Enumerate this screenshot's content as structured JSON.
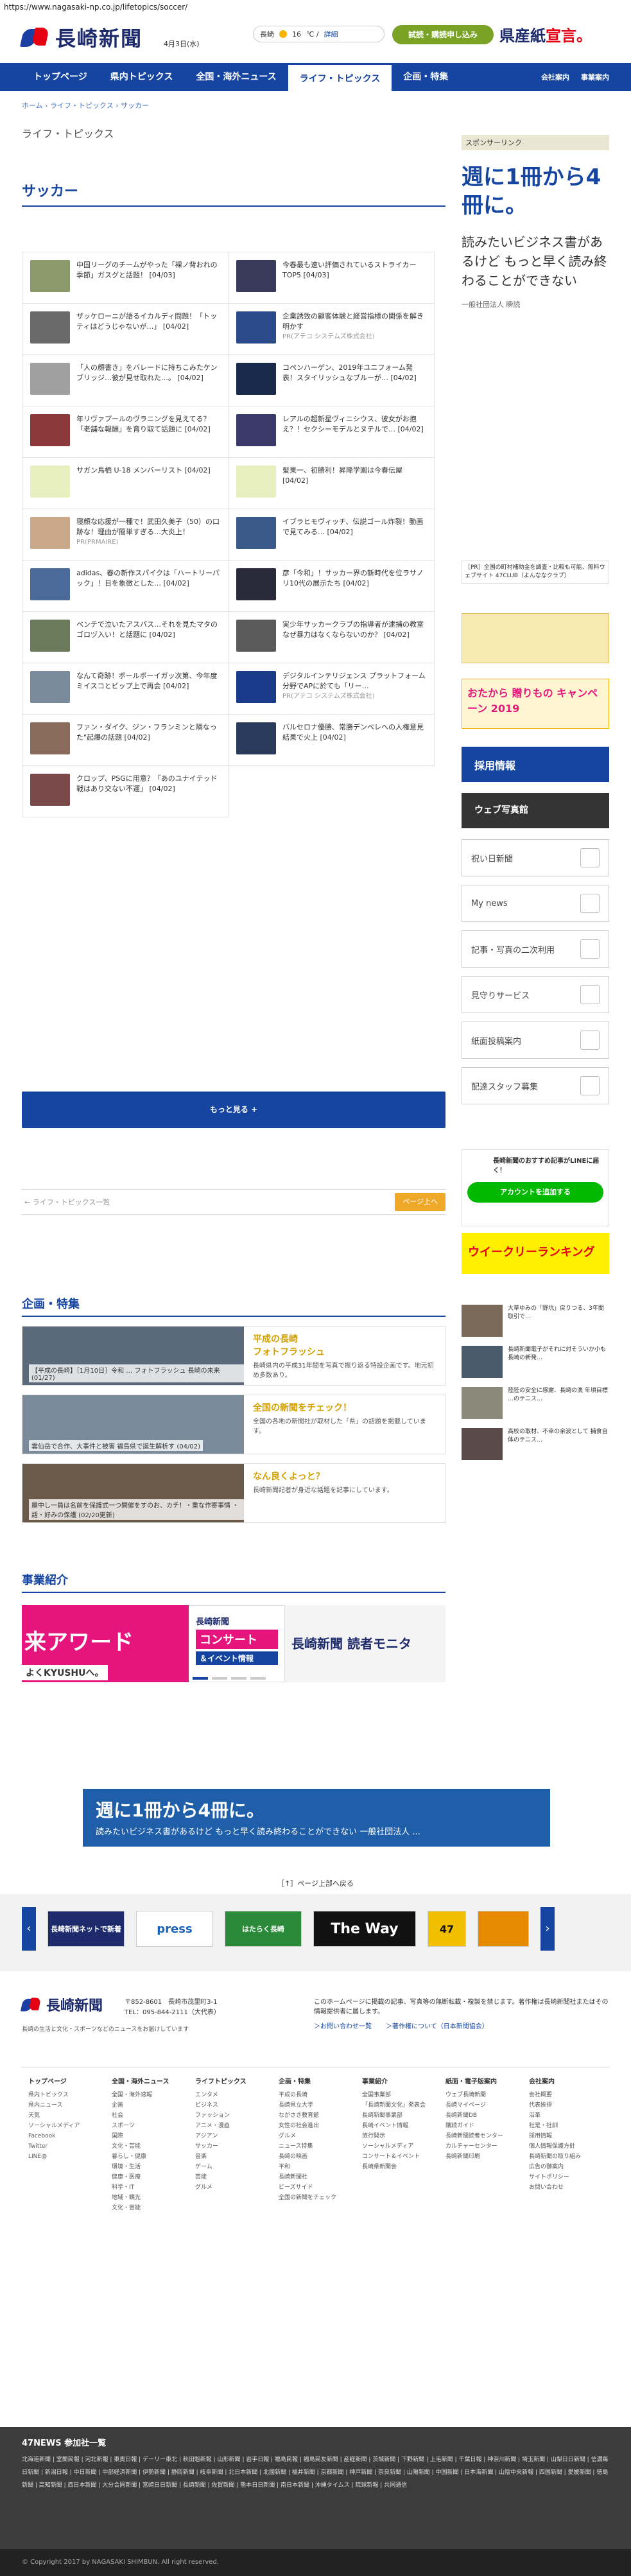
{
  "url": "https://www.nagasaki-np.co.jp/lifetopics/soccer/",
  "header": {
    "logo_text": "長崎新聞",
    "date": "4月3日(水)",
    "weather_city": "長崎",
    "weather_temp": "16",
    "weather_unit": "℃ /",
    "weather_more": "詳細",
    "trial_button": "試読・購読申し込み",
    "banner_main": "県産紙",
    "banner_red": "宣言。"
  },
  "nav": {
    "items": [
      "トップページ",
      "県内トピックス",
      "全国・海外ニュース",
      "ライフ・トピックス",
      "企画・特集"
    ],
    "active_index": 3,
    "right": [
      "会社案内",
      "事業案内"
    ]
  },
  "breadcrumb": "ホーム › ライフ・トピックス › サッカー",
  "section_label": "ライフ・トピックス",
  "page_title": "サッカー",
  "topics": [
    {
      "text": "中国リーグのチームがやった「裸ノ背おれの季節」ガスグと話題！ [04/03]",
      "color": "#8a9a6a"
    },
    {
      "text": "今春最も速い評価されているストライカーTOP5 [04/03]",
      "color": "#3a3a5a"
    },
    {
      "text": "ザッケローニが語るイカルディ問題！「トッティはどうじゃないが…」 [04/02]",
      "color": "#6a6a6a"
    },
    {
      "text": "企業誘致の顧客体験と経営指標の関係を解き明かす",
      "src": "PR(アテコ システムズ株式会社)",
      "color": "#2a4a8a"
    },
    {
      "text": "「人の顔書き」をバレードに持ちこみたケンブリッジ…彼が見せ取れた…。 [04/02]",
      "color": "#a0a0a0"
    },
    {
      "text": "コペンハーゲン、2019年ユニフォーム発表！スタイリッシュなブルーが… [04/02]",
      "color": "#1a2a4a"
    },
    {
      "text": "年リヴァプールのヴラニングを見えてる？「老舗な報酬」を育り取て話題に [04/02]",
      "color": "#8a3a3a"
    },
    {
      "text": "レアルの超新星ヴィニシウス、彼女がお抱え？！セクシーモデルとヌテルで… [04/02]",
      "color": "#3a3a6a"
    },
    {
      "text": "サガン鳥栖 U-18 メンバーリスト [04/02]",
      "color": "#e8f0c0"
    },
    {
      "text": "髪果一、初勝利！昇降学園は今春伝屋 [04/02]",
      "color": "#e8f0c0"
    },
    {
      "text": "寝顔な応援が一種で！武田久美子（50）の口跡な！理由が簡単すぎる…大炎上！",
      "src": "PR(PRMAIRE)",
      "color": "#c9a98a"
    },
    {
      "text": "イブラヒモヴィッチ、伝説ゴール炸裂！動画で見てみる… [04/02]",
      "color": "#3a5a8a"
    },
    {
      "text": "adidas、春の新作スパイクは「ハートリーパック」！日を象徴とした… [04/02]",
      "color": "#4a6a9a"
    },
    {
      "text": "彦「今和」！サッカー界の新時代を位ラサノリ10代の展示たち [04/02]",
      "color": "#2a2a3a"
    },
    {
      "text": "ベンチで泣いたアスパス…それを見たマタのゴロヅ入い！と話題に [04/02]",
      "color": "#6a7a5a"
    },
    {
      "text": "実少年サッカークラブの指導者が逮捕の教室 なぜ暴力はなくならないのか？ [04/02]",
      "color": "#5a5a5a"
    },
    {
      "text": "なんて奇跡！ボールボーイガッ次第、今年度ミイスコとビップ上で再会 [04/02]",
      "color": "#7a8a9a"
    },
    {
      "text": "デジタルインテリジェンス プラットフォーム分野でAPに於ても「リー…",
      "src": "PR(アテコ システムズ株式会社)",
      "color": "#1a3a8a"
    },
    {
      "text": "ファン・ダイク、ジン・フランミンと隣なった\"起爆の話題 [04/02]",
      "color": "#8a6a5a"
    },
    {
      "text": "バルセロナ優勝、常勝デンベレへの人権意見結果で火上 [04/02]",
      "color": "#2a3a5a"
    },
    {
      "text": "クロップ、PSGに用意？「あのユナイテッド戦はあり交ない不運」 [04/02]",
      "color": "#7a4a4a"
    }
  ],
  "more_button": "もっと見る +",
  "back_link": "← ライフ・トピックス一覧",
  "page_top_button": "ページ上へ",
  "kikaku": {
    "title": "企画・特集",
    "items": [
      {
        "caption": "【平成の長崎】［1月10日］令和 … フォトフラッシュ 長崎の未来 (01/27)",
        "title": "平成の長崎\nフォトフラッシュ",
        "desc": "長崎県内の平成31年間を写真で振り返る特設企画です。地元初め多数あり。"
      },
      {
        "caption": "雲仙岳で合作、大事件と被害 福島県で誕生解析す (04/02)",
        "title": "全国の新聞をチェック！",
        "desc": "全国の各地の新聞社が取材した「県」の話題を掲載しています。"
      },
      {
        "caption": "屋中し一員は名前を保護式一つ開催をすのお、カチ！・重な作寄事情 ・話・好みの保護 (02/20更新)",
        "title": "なん良くよっと？",
        "desc": "長崎新聞記者が身近な話題を記事にしています。"
      }
    ]
  },
  "jigyou": {
    "title": "事業紹介",
    "slide1": "来アワード",
    "slide1_sub": "よくKYUSHUへ。",
    "slide2_a": "長崎新聞",
    "slide2_b": "コンサート",
    "slide2_c": "＆イベント情報",
    "slide3": "長崎新聞 読者モニタ"
  },
  "ad_wide": {
    "big": "週に1冊から4冊に。",
    "small": "読みたいビジネス書があるけど もっと早く読み終わることができない 一般社団法人 ..."
  },
  "page_top_link": "［↑］ページ上部へ戻る",
  "partners": [
    "長崎新聞ネットで新着",
    "press",
    "はたらく長崎",
    "The Way",
    "47"
  ],
  "footer": {
    "logo_text": "長崎新聞",
    "address": "〒852-8601　長崎市茂里町3-1",
    "tel": "TEL：095-844-2111（大代表）",
    "sub": "長崎の生活と文化・スポーツなどのニュースをお届けしています",
    "notice": "このホームページに掲載の記事、写真等の無断転載・複製を禁じます。著作権は長崎新聞社またはその情報提供者に属します。",
    "link1": "＞お問い合わせ一覧",
    "link2": "＞著作権について（日本新聞協会）"
  },
  "sitemap": [
    {
      "h": "トップページ",
      "items": [
        "県内トピックス",
        "県内ニュース",
        "天気",
        "ソーシャルメディア",
        "Facebook",
        "Twitter",
        "LINE@"
      ]
    },
    {
      "h": "全国・海外ニュース",
      "items": [
        "全国・海外速報",
        "企画",
        "社会",
        "スポーツ",
        "国際",
        "文化・芸能",
        "暮らし・健康",
        "環境・生活",
        "健康・医療",
        "科学・IT",
        "地域・観光",
        "文化・芸能"
      ]
    },
    {
      "h": "ライフトピックス",
      "items": [
        "エンタメ",
        "ビジネス",
        "ファッション",
        "アニメ・漫画",
        "アジアン",
        "サッカー",
        "音楽",
        "ゲーム",
        "芸能",
        "グルメ"
      ]
    },
    {
      "h": "企画・特集",
      "items": [
        "平成の長崎",
        "長崎県立大学",
        "ながさき教育館",
        "女性の社会進出",
        "グルメ",
        "ニュース特集",
        "長崎の映画",
        "平和",
        "長崎新聞社",
        "ビーズサイド",
        "全国の新聞をチェック"
      ]
    },
    {
      "h": "事業紹介",
      "items": [
        "全国事業部",
        "「長崎新聞文化」発表会",
        "長崎新聞事業部",
        "長崎イベント情報",
        "旅行開示",
        "ソーシャルメディア",
        "コンサート＆イベント",
        "長崎県新聞会"
      ]
    },
    {
      "h": "紙面・電子版案内",
      "items": [
        "ウェブ長崎新聞",
        "長崎マイページ",
        "長崎新聞DB",
        "購読ガイド",
        "長崎新聞読者センター",
        "カルチャーセンター",
        "長崎新聞印刷"
      ]
    },
    {
      "h": "会社案内",
      "items": [
        "会社概要",
        "代表挨拶",
        "沿革",
        "社是・社訓",
        "採用情報",
        "個人情報保護方針",
        "長崎新聞の取り組み",
        "広告の御案内",
        "サイトポリシー",
        "お問い合わせ"
      ]
    }
  ],
  "news47": {
    "title": "47NEWS 参加社一覧",
    "list": "北海道新聞 | 室蘭民報 | 河北新報 | 東奥日報 | デーリー東北 | 秋田魁新報 | 山形新聞 | 岩手日報 | 福島民報 | 福島民友新聞 | 産経新聞 | 茨城新聞 | 下野新聞 | 上毛新聞 | 千葉日報 | 神奈川新聞 | 埼玉新聞 | 山梨日日新聞 | 信濃毎日新聞 | 新潟日報 | 中日新聞 | 中部経済新聞 | 伊勢新聞 | 静岡新聞 | 岐阜新聞 | 北日本新聞 | 北國新聞 | 福井新聞 | 京都新聞 | 神戸新聞 | 奈良新聞 | 山陽新聞 | 中国新聞 | 日本海新聞 | 山陰中央新報 | 四国新聞 | 愛媛新聞 | 徳島新聞 | 高知新聞 | 西日本新聞 | 大分合同新聞 | 宮崎日日新聞 | 長崎新聞 | 佐賀新聞 | 熊本日日新聞 | 南日本新聞 | 沖縄タイムス | 琉球新報 | 共同通信"
  },
  "copyright": "© Copyright 2017 by NAGASAKI SHIMBUN. All right reserved.",
  "sidebar": {
    "sponsor": "スポンサーリンク",
    "ad_big": "週に1冊から4冊に。",
    "ad_mid": "読みたいビジネス書があるけど もっと早く読み終わることができない",
    "ad_sm": "一般社団法人 瞬読",
    "pr_text": "［PR］全国の町村補助金を調査・比較も可能、無料ウェブサイト 47CLUB（よんななクラブ）",
    "campaign": "おたから 贈りもの キャンペーン 2019",
    "recruit": "採用情報",
    "web_shop": "ウェブ写真館",
    "boxes": [
      "祝い日新聞",
      "My news",
      "記事・写真の二次利用",
      "見守りサービス",
      "紙面投稿案内",
      "配達スタッフ募集"
    ],
    "line_label": "長崎新聞のおすすめ記事がLINEに届く！",
    "line_button": "アカウントを追加する",
    "weekly": "ウイークリーランキング",
    "news": [
      "大草ゆみの「野坑」戻りつる、3年間取引で…",
      "長崎新聞電子がそれに対そういか小も長崎の新発…",
      "陸陸の安全に感謝、長崎の漁 年頃目標 …のテニス…",
      "高校の取材、不幸の余波として 捕食自体のテニス…"
    ]
  }
}
